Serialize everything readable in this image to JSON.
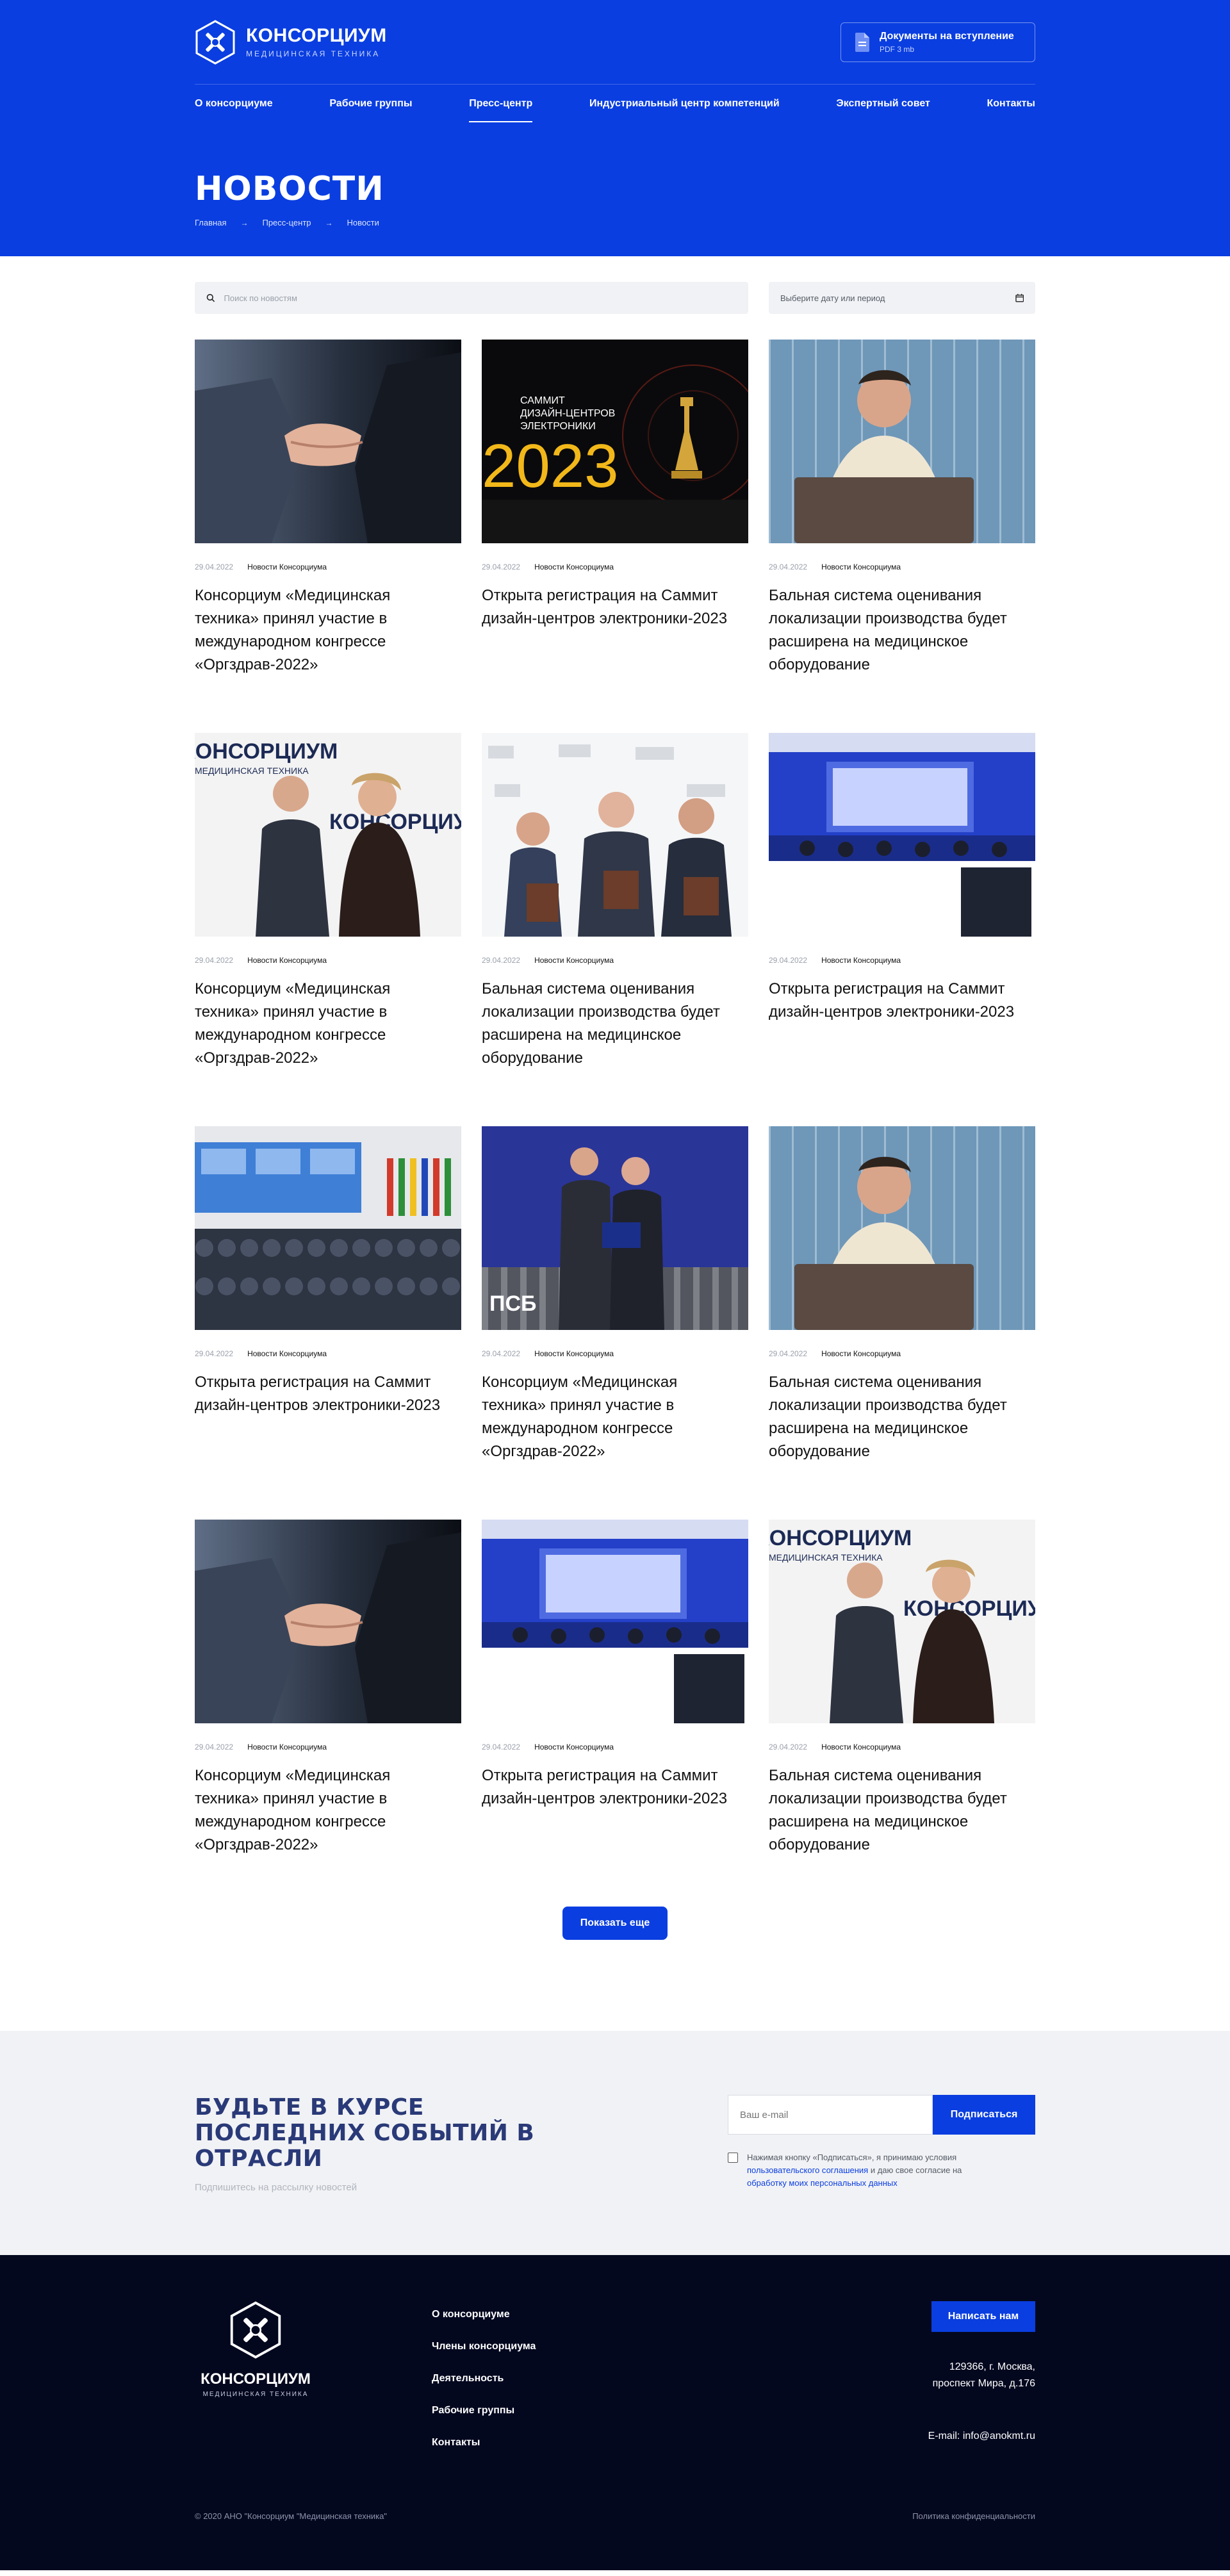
{
  "header": {
    "logo_title": "КОНСОРЦИУМ",
    "logo_subtitle": "МЕДИЦИНСКАЯ ТЕХНИКА",
    "doc_button_title": "Документы на вступление",
    "doc_button_sub": "PDF 3 mb"
  },
  "nav": [
    {
      "label": "О консорциуме"
    },
    {
      "label": "Рабочие группы"
    },
    {
      "label": "Пресс-центр"
    },
    {
      "label": "Индустриальный центр компетенций"
    },
    {
      "label": "Экспертный совет"
    },
    {
      "label": "Контакты"
    }
  ],
  "page": {
    "title": "НОВОСТИ",
    "breadcrumbs": [
      "Главная",
      "Пресс-центр",
      "Новости"
    ]
  },
  "filters": {
    "search_placeholder": "Поиск по новостям",
    "date_placeholder": "Выберите дату или период"
  },
  "news": [
    {
      "date": "29.04.2022",
      "category": "Новости Консорциума",
      "title": "Консорциум «Медицинская техника» принял участие в международном конгрессе «Оргздрав-2022»",
      "image": "handshake"
    },
    {
      "date": "29.04.2022",
      "category": "Новости Консорциума",
      "title": "Открыта регистрация на Саммит дизайн-центров электроники-2023",
      "image": "summit"
    },
    {
      "date": "29.04.2022",
      "category": "Новости Консорциума",
      "title": "Бальная система оценивания локализации производства будет расширена на медицинское оборудование",
      "image": "laptop-man"
    },
    {
      "date": "29.04.2022",
      "category": "Новости Консорциума",
      "title": "Консорциум «Медицинская техника» принял участие в международном конгрессе «Оргздрав-2022»",
      "image": "press-wall"
    },
    {
      "date": "29.04.2022",
      "category": "Новости Консорциума",
      "title": "Бальная система оценивания локализации производства будет расширена на медицинское оборудование",
      "image": "three-men"
    },
    {
      "date": "29.04.2022",
      "category": "Новости Консорциума",
      "title": "Открыта регистрация на Саммит дизайн-центров электроники-2023",
      "image": "panel"
    },
    {
      "date": "29.04.2022",
      "category": "Новости Консорциума",
      "title": "Открыта регистрация на Саммит дизайн-центров электроники-2023",
      "image": "audience"
    },
    {
      "date": "29.04.2022",
      "category": "Новости Консорциума",
      "title": "Консорциум «Медицинская техника» принял участие в международном конгрессе «Оргздрав-2022»",
      "image": "psb"
    },
    {
      "date": "29.04.2022",
      "category": "Новости Консорциума",
      "title": "Бальная система оценивания локализации производства будет расширена на медицинское оборудование",
      "image": "laptop-man"
    },
    {
      "date": "29.04.2022",
      "category": "Новости Консорциума",
      "title": "Консорциум «Медицинская техника» принял участие в международном конгрессе «Оргздрав-2022»",
      "image": "handshake"
    },
    {
      "date": "29.04.2022",
      "category": "Новости Консорциума",
      "title": "Открыта регистрация на Саммит дизайн-центров электроники-2023",
      "image": "panel"
    },
    {
      "date": "29.04.2022",
      "category": "Новости Консорциума",
      "title": "Бальная система оценивания локализации производства будет расширена на медицинское оборудование",
      "image": "press-wall"
    }
  ],
  "summit_image_text": {
    "line1": "САММИТ",
    "line2": "ДИЗАЙН-ЦЕНТРОВ",
    "line3": "ЭЛЕКТРОНИКИ",
    "year": "2023"
  },
  "press_wall_text": {
    "word": "КОНСОРЦИУМ",
    "sub": "МЕДИЦИНСКАЯ ТЕХНИКА"
  },
  "psb_text": "ПСБ",
  "more_button": "Показать еще",
  "subscribe": {
    "title": "БУДЬТЕ В КУРСЕ ПОСЛЕДНИХ СОБЫТИЙ В ОТРАСЛИ",
    "note": "Подпишитесь на рассылку новостей",
    "email_placeholder": "Ваш e-mail",
    "button": "Подписаться",
    "agree_text_1": "Нажимая кнопку «Подписаться», я принимаю условия",
    "agree_link_1": "пользовательского соглашения",
    "agree_text_2": "и даю свое согласие на",
    "agree_link_2": "обработку моих персональных данных"
  },
  "footer": {
    "logo_title": "КОНСОРЦИУМ",
    "logo_subtitle": "МЕДИЦИНСКАЯ ТЕХНИКА",
    "links": [
      "О консорциуме",
      "Члены консорциума",
      "Деятельность",
      "Рабочие группы",
      "Контакты"
    ],
    "write_button": "Написать нам",
    "address_line1": "129366, г. Москва,",
    "address_line2": "проспект Мира, д.176",
    "email": "E-mail: info@anokmt.ru",
    "copyright": "© 2020 АНО \"Консорциум \"Медицинская техника\"",
    "privacy": "Политика конфиденциальности"
  },
  "colors": {
    "brand": "#0a3ee0",
    "footer_bg": "#04081f",
    "subscribe_title": "#2a3a78"
  }
}
